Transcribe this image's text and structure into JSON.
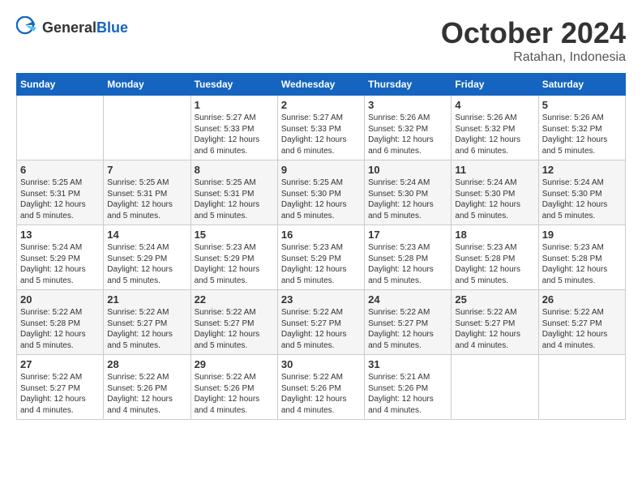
{
  "header": {
    "logo_general": "General",
    "logo_blue": "Blue",
    "month": "October 2024",
    "location": "Ratahan, Indonesia"
  },
  "columns": [
    "Sunday",
    "Monday",
    "Tuesday",
    "Wednesday",
    "Thursday",
    "Friday",
    "Saturday"
  ],
  "weeks": [
    [
      {
        "day": "",
        "detail": ""
      },
      {
        "day": "",
        "detail": ""
      },
      {
        "day": "1",
        "detail": "Sunrise: 5:27 AM\nSunset: 5:33 PM\nDaylight: 12 hours\nand 6 minutes."
      },
      {
        "day": "2",
        "detail": "Sunrise: 5:27 AM\nSunset: 5:33 PM\nDaylight: 12 hours\nand 6 minutes."
      },
      {
        "day": "3",
        "detail": "Sunrise: 5:26 AM\nSunset: 5:32 PM\nDaylight: 12 hours\nand 6 minutes."
      },
      {
        "day": "4",
        "detail": "Sunrise: 5:26 AM\nSunset: 5:32 PM\nDaylight: 12 hours\nand 6 minutes."
      },
      {
        "day": "5",
        "detail": "Sunrise: 5:26 AM\nSunset: 5:32 PM\nDaylight: 12 hours\nand 5 minutes."
      }
    ],
    [
      {
        "day": "6",
        "detail": "Sunrise: 5:25 AM\nSunset: 5:31 PM\nDaylight: 12 hours\nand 5 minutes."
      },
      {
        "day": "7",
        "detail": "Sunrise: 5:25 AM\nSunset: 5:31 PM\nDaylight: 12 hours\nand 5 minutes."
      },
      {
        "day": "8",
        "detail": "Sunrise: 5:25 AM\nSunset: 5:31 PM\nDaylight: 12 hours\nand 5 minutes."
      },
      {
        "day": "9",
        "detail": "Sunrise: 5:25 AM\nSunset: 5:30 PM\nDaylight: 12 hours\nand 5 minutes."
      },
      {
        "day": "10",
        "detail": "Sunrise: 5:24 AM\nSunset: 5:30 PM\nDaylight: 12 hours\nand 5 minutes."
      },
      {
        "day": "11",
        "detail": "Sunrise: 5:24 AM\nSunset: 5:30 PM\nDaylight: 12 hours\nand 5 minutes."
      },
      {
        "day": "12",
        "detail": "Sunrise: 5:24 AM\nSunset: 5:30 PM\nDaylight: 12 hours\nand 5 minutes."
      }
    ],
    [
      {
        "day": "13",
        "detail": "Sunrise: 5:24 AM\nSunset: 5:29 PM\nDaylight: 12 hours\nand 5 minutes."
      },
      {
        "day": "14",
        "detail": "Sunrise: 5:24 AM\nSunset: 5:29 PM\nDaylight: 12 hours\nand 5 minutes."
      },
      {
        "day": "15",
        "detail": "Sunrise: 5:23 AM\nSunset: 5:29 PM\nDaylight: 12 hours\nand 5 minutes."
      },
      {
        "day": "16",
        "detail": "Sunrise: 5:23 AM\nSunset: 5:29 PM\nDaylight: 12 hours\nand 5 minutes."
      },
      {
        "day": "17",
        "detail": "Sunrise: 5:23 AM\nSunset: 5:28 PM\nDaylight: 12 hours\nand 5 minutes."
      },
      {
        "day": "18",
        "detail": "Sunrise: 5:23 AM\nSunset: 5:28 PM\nDaylight: 12 hours\nand 5 minutes."
      },
      {
        "day": "19",
        "detail": "Sunrise: 5:23 AM\nSunset: 5:28 PM\nDaylight: 12 hours\nand 5 minutes."
      }
    ],
    [
      {
        "day": "20",
        "detail": "Sunrise: 5:22 AM\nSunset: 5:28 PM\nDaylight: 12 hours\nand 5 minutes."
      },
      {
        "day": "21",
        "detail": "Sunrise: 5:22 AM\nSunset: 5:27 PM\nDaylight: 12 hours\nand 5 minutes."
      },
      {
        "day": "22",
        "detail": "Sunrise: 5:22 AM\nSunset: 5:27 PM\nDaylight: 12 hours\nand 5 minutes."
      },
      {
        "day": "23",
        "detail": "Sunrise: 5:22 AM\nSunset: 5:27 PM\nDaylight: 12 hours\nand 5 minutes."
      },
      {
        "day": "24",
        "detail": "Sunrise: 5:22 AM\nSunset: 5:27 PM\nDaylight: 12 hours\nand 5 minutes."
      },
      {
        "day": "25",
        "detail": "Sunrise: 5:22 AM\nSunset: 5:27 PM\nDaylight: 12 hours\nand 4 minutes."
      },
      {
        "day": "26",
        "detail": "Sunrise: 5:22 AM\nSunset: 5:27 PM\nDaylight: 12 hours\nand 4 minutes."
      }
    ],
    [
      {
        "day": "27",
        "detail": "Sunrise: 5:22 AM\nSunset: 5:27 PM\nDaylight: 12 hours\nand 4 minutes."
      },
      {
        "day": "28",
        "detail": "Sunrise: 5:22 AM\nSunset: 5:26 PM\nDaylight: 12 hours\nand 4 minutes."
      },
      {
        "day": "29",
        "detail": "Sunrise: 5:22 AM\nSunset: 5:26 PM\nDaylight: 12 hours\nand 4 minutes."
      },
      {
        "day": "30",
        "detail": "Sunrise: 5:22 AM\nSunset: 5:26 PM\nDaylight: 12 hours\nand 4 minutes."
      },
      {
        "day": "31",
        "detail": "Sunrise: 5:21 AM\nSunset: 5:26 PM\nDaylight: 12 hours\nand 4 minutes."
      },
      {
        "day": "",
        "detail": ""
      },
      {
        "day": "",
        "detail": ""
      }
    ]
  ]
}
